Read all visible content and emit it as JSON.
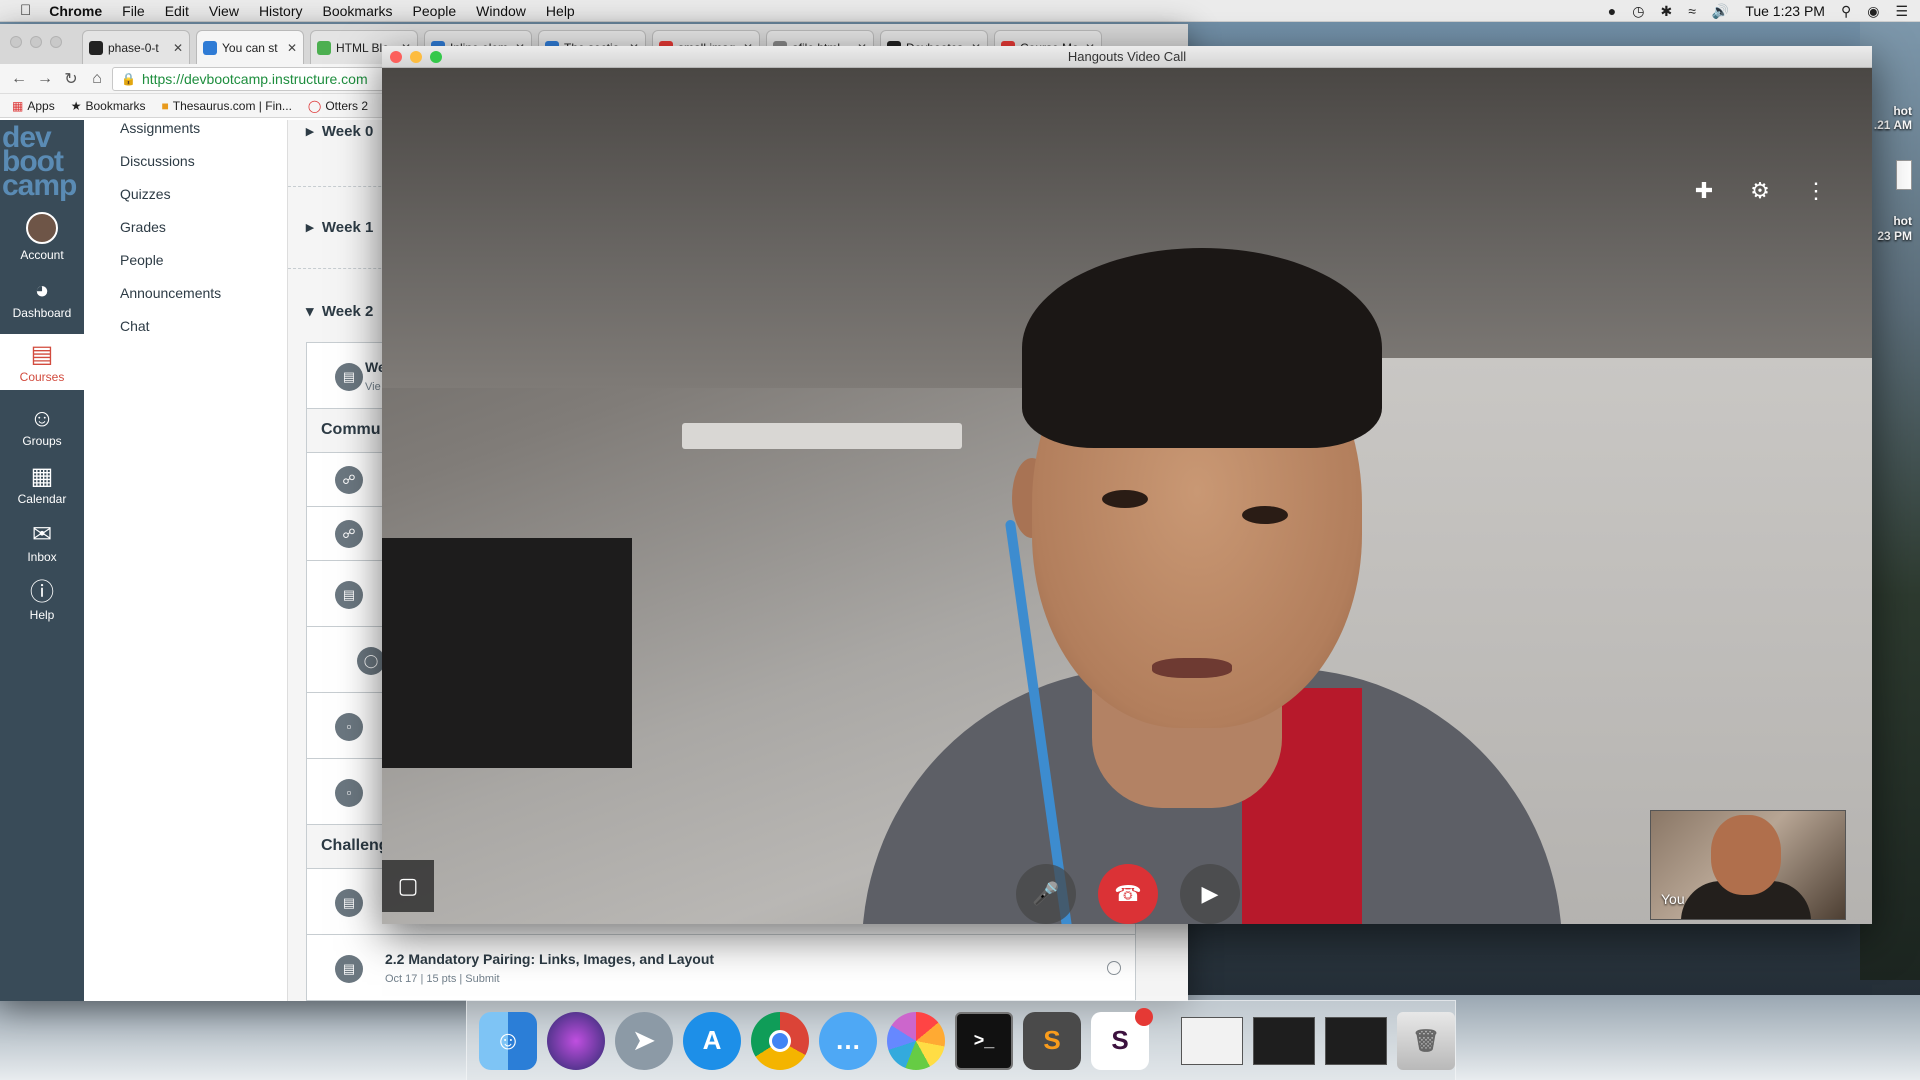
{
  "menubar": {
    "app_name": "Chrome",
    "menus": [
      "File",
      "Edit",
      "View",
      "History",
      "Bookmarks",
      "People",
      "Window",
      "Help"
    ],
    "clock": "Tue 1:23 PM"
  },
  "desktop": {
    "labels": [
      "hot",
      ".21 AM",
      "hot",
      "23 PM"
    ]
  },
  "chrome": {
    "tabs": [
      {
        "title": "phase-0-t",
        "color": "#222222"
      },
      {
        "title": "You can st",
        "color": "#2f7bd5"
      },
      {
        "title": "HTML Blo",
        "color": "#4caf50"
      },
      {
        "title": "Inline elem",
        "color": "#2f7bd5"
      },
      {
        "title": "The sectio",
        "color": "#2f7bd5"
      },
      {
        "title": "small imag",
        "color": "#e53935"
      },
      {
        "title": "afile.html",
        "color": "#888888"
      },
      {
        "title": "Devbootca",
        "color": "#222222"
      },
      {
        "title": "Course Mo",
        "color": "#e53935"
      }
    ],
    "url": "https://devbootcamp.instructure.com",
    "bookmarks": [
      "Apps",
      "Bookmarks",
      "Thesaurus.com | Fin...",
      "Otters 2"
    ]
  },
  "canvas": {
    "logo_lines": [
      "dev",
      "boot",
      "camp"
    ],
    "global_nav": [
      {
        "label": "Account",
        "icon": "account-icon"
      },
      {
        "label": "Dashboard",
        "icon": "dashboard-icon"
      },
      {
        "label": "Courses",
        "icon": "courses-icon"
      },
      {
        "label": "Groups",
        "icon": "groups-icon"
      },
      {
        "label": "Calendar",
        "icon": "calendar-icon"
      },
      {
        "label": "Inbox",
        "icon": "inbox-icon"
      },
      {
        "label": "Help",
        "icon": "help-icon"
      }
    ],
    "course_nav": [
      "Assignments",
      "Discussions",
      "Quizzes",
      "Grades",
      "People",
      "Announcements",
      "Chat"
    ],
    "weeks": [
      "Week 0",
      "Week 1",
      "Week 2"
    ],
    "module": {
      "first_item_title": "We",
      "first_item_meta": "Vie",
      "section_1": "Commu",
      "section_2": "Challeng",
      "last_item_title": "2.2 Mandatory Pairing: Links, Images, and Layout",
      "last_item_meta": "Oct 17  |  15 pts  |  Submit"
    }
  },
  "hangouts": {
    "title": "Hangouts Video Call",
    "self_label": "You"
  },
  "colors": {
    "canvas_nav": "#394b58",
    "active_course": "#d24b3e",
    "hangup": "#db3236"
  }
}
